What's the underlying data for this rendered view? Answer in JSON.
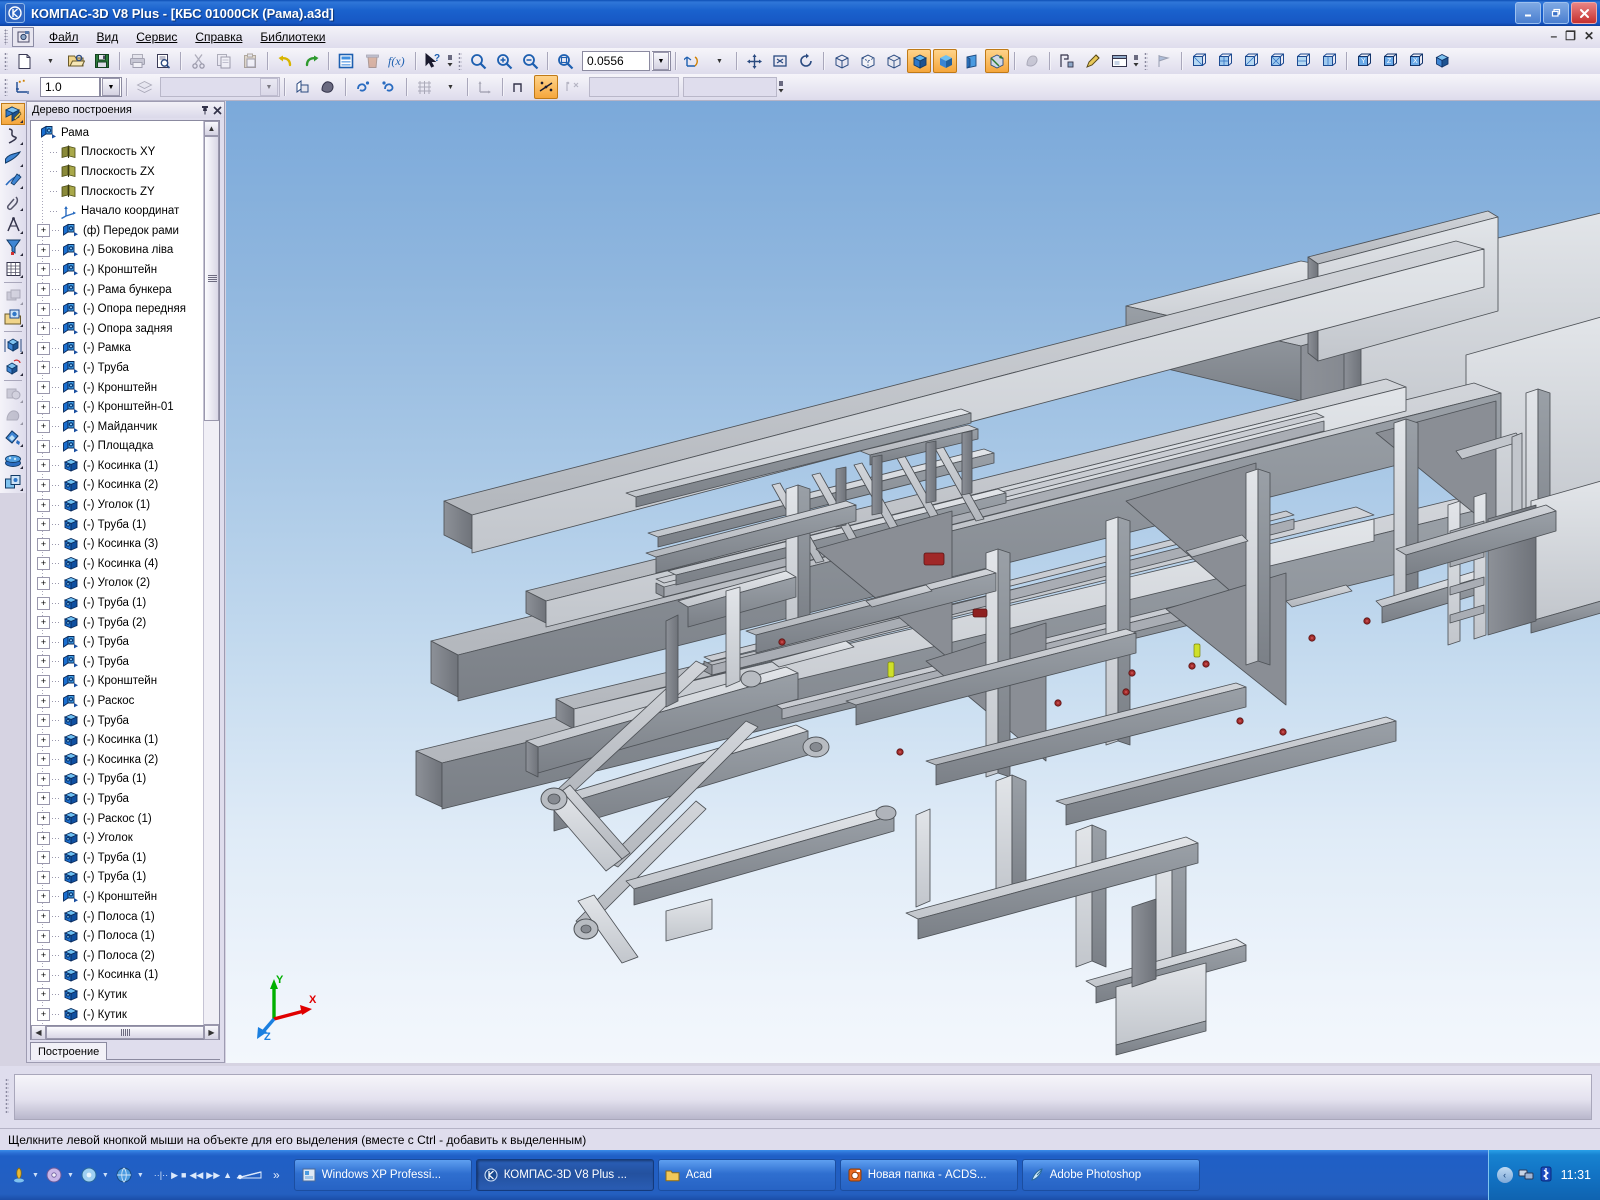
{
  "window": {
    "title": "КОМПАС-3D V8 Plus - [КБС 01000СК (Рама).a3d]",
    "app_icon": "kompas-logo-icon",
    "buttons": {
      "minimize": "_",
      "restore": "❐",
      "close": "✕"
    },
    "mdi_buttons": {
      "minimize": "–",
      "restore": "❐",
      "close": "✕"
    }
  },
  "menu": {
    "items": [
      {
        "label": "Файл"
      },
      {
        "label": "Вид"
      },
      {
        "label": "Сервис"
      },
      {
        "label": "Справка"
      },
      {
        "label": "Библиотеки"
      }
    ]
  },
  "toolbar_standard": {
    "buttons": [
      {
        "name": "new-document",
        "icon": "page-icon"
      },
      {
        "name": "new-document-dropdown",
        "icon": "chevron-down-icon"
      },
      {
        "name": "open-document",
        "icon": "folder-open-icon"
      },
      {
        "name": "save-document",
        "icon": "floppy-disk-icon"
      },
      {
        "name": "print",
        "icon": "printer-icon"
      },
      {
        "name": "print-preview",
        "icon": "preview-icon"
      },
      {
        "name": "cut",
        "icon": "scissors-icon"
      },
      {
        "name": "copy",
        "icon": "copy-icon"
      },
      {
        "name": "paste",
        "icon": "paste-icon"
      },
      {
        "name": "undo",
        "icon": "undo-arrow-icon"
      },
      {
        "name": "redo",
        "icon": "redo-arrow-icon"
      },
      {
        "name": "properties",
        "icon": "properties-icon"
      },
      {
        "name": "delete-object",
        "icon": "trash-icon"
      },
      {
        "name": "variables",
        "icon": "fx-icon"
      },
      {
        "name": "context-help",
        "icon": "arrow-question-icon"
      }
    ]
  },
  "toolbar_view": {
    "zoom_buttons": [
      {
        "name": "zoom-window",
        "icon": "magnifier-icon"
      },
      {
        "name": "zoom-in",
        "icon": "magnifier-plus-icon"
      },
      {
        "name": "zoom-out",
        "icon": "magnifier-minus-icon"
      },
      {
        "name": "zoom-to-fit",
        "icon": "magnifier-fit-icon"
      }
    ],
    "scale_value": "0.0556",
    "rotate_icon": "rotate-3d-icon"
  },
  "toolbar_orientation": {
    "buttons": [
      {
        "name": "pan-view",
        "icon": "move-arrows-icon"
      },
      {
        "name": "zoom-region",
        "icon": "zoom-region-icon"
      },
      {
        "name": "refresh-view",
        "icon": "refresh-icon"
      },
      {
        "name": "wireframe",
        "icon": "wireframe-cube-icon"
      },
      {
        "name": "hidden-lines-thin",
        "icon": "hidden-lines-cube-icon"
      },
      {
        "name": "no-hidden-lines",
        "icon": "no-hidden-lines-cube-icon"
      },
      {
        "name": "shaded-with-edges",
        "icon": "shaded-edges-cube-icon",
        "active": true
      },
      {
        "name": "shaded",
        "icon": "shaded-cube-icon",
        "active": true
      },
      {
        "name": "perspective",
        "icon": "perspective-icon"
      },
      {
        "name": "section-view",
        "icon": "section-cube-icon",
        "active": true
      },
      {
        "name": "simplify-display",
        "icon": "simplify-icon"
      },
      {
        "name": "light-source",
        "icon": "light-source-icon"
      },
      {
        "name": "edit-materials",
        "icon": "brush-icon"
      },
      {
        "name": "new-window",
        "icon": "window-icon"
      }
    ]
  },
  "toolbar_views": {
    "buttons": [
      {
        "name": "view-list",
        "icon": "view-flag-icon"
      },
      {
        "name": "view-front",
        "icon": "cube-front-icon"
      },
      {
        "name": "view-back",
        "icon": "cube-back-icon"
      },
      {
        "name": "view-left",
        "icon": "cube-left-icon"
      },
      {
        "name": "view-right",
        "icon": "cube-right-icon"
      },
      {
        "name": "view-top",
        "icon": "cube-top-icon"
      },
      {
        "name": "view-bottom",
        "icon": "cube-bottom-icon"
      },
      {
        "name": "view-isometric-xyz",
        "icon": "cube-iso-y-icon"
      },
      {
        "name": "view-isometric-yzx",
        "icon": "cube-iso-z-icon"
      },
      {
        "name": "view-isometric-zxy",
        "icon": "cube-iso-x-icon"
      },
      {
        "name": "view-dimetry",
        "icon": "cube-dimetry-icon"
      }
    ]
  },
  "toolbar_current_state": {
    "snap_value": "1.0",
    "buttons": [
      {
        "name": "snap-points",
        "icon": "snap-points-icon"
      },
      {
        "name": "layers",
        "icon": "layers-icon"
      },
      {
        "name": "hide-show-objects",
        "icon": "hide-objects-icon"
      },
      {
        "name": "hide-bodies",
        "icon": "hide-bodies-icon"
      },
      {
        "name": "hide-constraints",
        "icon": "hide-constraint-icon"
      },
      {
        "name": "show-constraints",
        "icon": "show-constraint-icon"
      },
      {
        "name": "grid",
        "icon": "grid-icon"
      },
      {
        "name": "grid-dropdown",
        "icon": "chevron-down-icon"
      },
      {
        "name": "local-coordinates",
        "icon": "local-cs-icon"
      },
      {
        "name": "ortho-mode",
        "icon": "ortho-icon"
      },
      {
        "name": "global-snaps",
        "icon": "global-snap-icon",
        "active": true
      },
      {
        "name": "disable-snaps",
        "icon": "disable-snap-icon"
      }
    ],
    "layer_field": "",
    "field_a": "",
    "field_b": ""
  },
  "left_toolbar": {
    "buttons": [
      {
        "name": "edit-model-tool",
        "icon": "edit-model-icon",
        "active": true
      },
      {
        "name": "spatial-curves-tool",
        "icon": "spline-icon"
      },
      {
        "name": "surfaces-tool",
        "icon": "surface-icon"
      },
      {
        "name": "sketch-tool",
        "icon": "sketch-icon"
      },
      {
        "name": "auxiliary-geometry-tool",
        "icon": "paperclip-icon"
      },
      {
        "name": "measure-tool",
        "icon": "compass-icon"
      },
      {
        "name": "filters-tool",
        "icon": "filter-icon"
      },
      {
        "name": "specification-tool",
        "icon": "spreadsheet-icon"
      },
      {
        "name": "array-tool",
        "icon": "array-icon"
      },
      {
        "name": "insert-component-tool",
        "icon": "insert-part-icon"
      },
      {
        "name": "mate-tool",
        "icon": "mate-cube-icon"
      },
      {
        "name": "move-component-tool",
        "icon": "move-cube-icon"
      },
      {
        "name": "boolean-tool",
        "icon": "boolean-icon"
      },
      {
        "name": "cut-tool",
        "icon": "cut-solid-icon"
      },
      {
        "name": "properties-tool",
        "icon": "material-icon"
      },
      {
        "name": "library-tool",
        "icon": "library-icon"
      },
      {
        "name": "components-tool",
        "icon": "components-icon"
      }
    ]
  },
  "tree_panel": {
    "header": {
      "title": "Дерево построения",
      "pin_icon": "pin-icon",
      "close_icon": "close-icon"
    },
    "root": {
      "label": "Рама",
      "icon": "assembly-icon"
    },
    "items": [
      {
        "label": "Плоскость XY",
        "icon": "plane-icon",
        "expandable": false
      },
      {
        "label": "Плоскость ZX",
        "icon": "plane-icon",
        "expandable": false
      },
      {
        "label": "Плоскость ZY",
        "icon": "plane-icon",
        "expandable": false
      },
      {
        "label": "Начало координат",
        "icon": "origin-icon",
        "expandable": false
      },
      {
        "label": "(ф) Передок рами",
        "icon": "assembly-icon",
        "expandable": true
      },
      {
        "label": "(-) Боковина ліва",
        "icon": "assembly-icon",
        "expandable": true
      },
      {
        "label": "(-) Кронштейн",
        "icon": "assembly-icon",
        "expandable": true
      },
      {
        "label": "(-) Рама бункера",
        "icon": "assembly-icon",
        "expandable": true
      },
      {
        "label": "(-) Опора передняя",
        "icon": "assembly-icon",
        "expandable": true
      },
      {
        "label": "(-) Опора задняя",
        "icon": "assembly-icon",
        "expandable": true
      },
      {
        "label": "(-) Рамка",
        "icon": "assembly-icon",
        "expandable": true
      },
      {
        "label": "(-) Труба",
        "icon": "assembly-icon",
        "expandable": true
      },
      {
        "label": "(-) Кронштейн",
        "icon": "assembly-icon",
        "expandable": true
      },
      {
        "label": "(-) Кронштейн-01",
        "icon": "assembly-icon",
        "expandable": true
      },
      {
        "label": "(-) Майданчик",
        "icon": "assembly-icon",
        "expandable": true
      },
      {
        "label": "(-) Площадка",
        "icon": "assembly-icon",
        "expandable": true
      },
      {
        "label": "(-) Косинка (1)",
        "icon": "part-icon",
        "expandable": true
      },
      {
        "label": "(-) Косинка (2)",
        "icon": "part-icon",
        "expandable": true
      },
      {
        "label": "(-) Уголок (1)",
        "icon": "part-icon",
        "expandable": true
      },
      {
        "label": "(-)  Труба (1)",
        "icon": "part-icon",
        "expandable": true
      },
      {
        "label": "(-) Косинка (3)",
        "icon": "part-icon",
        "expandable": true
      },
      {
        "label": "(-) Косинка (4)",
        "icon": "part-icon",
        "expandable": true
      },
      {
        "label": "(-) Уголок (2)",
        "icon": "part-icon",
        "expandable": true
      },
      {
        "label": "(-)  Труба (1)",
        "icon": "part-icon",
        "expandable": true
      },
      {
        "label": "(-)  Труба (2)",
        "icon": "part-icon",
        "expandable": true
      },
      {
        "label": "(-) Труба",
        "icon": "assembly-icon",
        "expandable": true
      },
      {
        "label": "(-) Труба",
        "icon": "assembly-icon",
        "expandable": true
      },
      {
        "label": "(-) Кронштейн",
        "icon": "assembly-icon",
        "expandable": true
      },
      {
        "label": "(-) Раскос",
        "icon": "assembly-icon",
        "expandable": true
      },
      {
        "label": "(-) Труба",
        "icon": "part-icon",
        "expandable": true
      },
      {
        "label": "(-) Косинка (1)",
        "icon": "part-icon",
        "expandable": true
      },
      {
        "label": "(-) Косинка (2)",
        "icon": "part-icon",
        "expandable": true
      },
      {
        "label": "(-)  Труба (1)",
        "icon": "part-icon",
        "expandable": true
      },
      {
        "label": "(-)  Труба",
        "icon": "part-icon",
        "expandable": true
      },
      {
        "label": "(-) Раскос (1)",
        "icon": "part-icon",
        "expandable": true
      },
      {
        "label": "(-)  Уголок",
        "icon": "part-icon",
        "expandable": true
      },
      {
        "label": "(-)  Труба (1)",
        "icon": "part-icon",
        "expandable": true
      },
      {
        "label": "(-)  Труба (1)",
        "icon": "part-icon",
        "expandable": true
      },
      {
        "label": "(-) Кронштейн",
        "icon": "assembly-icon",
        "expandable": true
      },
      {
        "label": "(-)  Полоса (1)",
        "icon": "part-icon",
        "expandable": true
      },
      {
        "label": "(-) Полоса (1)",
        "icon": "part-icon",
        "expandable": true
      },
      {
        "label": "(-) Полоса (2)",
        "icon": "part-icon",
        "expandable": true
      },
      {
        "label": "(-) Косинка (1)",
        "icon": "part-icon",
        "expandable": true
      },
      {
        "label": "(-) Кутик",
        "icon": "part-icon",
        "expandable": true
      },
      {
        "label": "(-) Кутик",
        "icon": "part-icon",
        "expandable": true
      }
    ],
    "tab": {
      "label": "Построение"
    },
    "scroll": {
      "up_arrow": "▲",
      "down_arrow": "▼",
      "left_arrow": "◀",
      "right_arrow": "▶"
    }
  },
  "viewport": {
    "model_name": "Рама",
    "axes": {
      "x": "X",
      "y": "Y",
      "z": "Z"
    },
    "axis_colors": {
      "x": "#e00000",
      "y": "#00b000",
      "z": "#1a7fe0"
    },
    "background_top": "#7ba9da",
    "background_bottom": "#f3f7fc",
    "model_color": "#b9bcc2"
  },
  "status_bar": {
    "message": "Щелкните левой кнопкой мыши на объекте для его выделения (вместе с Ctrl - добавить к выделенным)"
  },
  "taskbar": {
    "start_items": [
      {
        "name": "quick-launch-media",
        "icon": "media-icon"
      },
      {
        "name": "quick-launch-disc",
        "icon": "disc-icon"
      },
      {
        "name": "quick-launch-volume",
        "icon": "volume-icon"
      },
      {
        "name": "quick-launch-browser",
        "icon": "browser-icon"
      }
    ],
    "media_controls": [
      "▶",
      "■",
      "◀◀",
      "▶▶",
      "▲"
    ],
    "more": "»",
    "tasks": [
      {
        "label": "Windows XP Professi...",
        "icon": "windows-icon",
        "active": false
      },
      {
        "label": "КОМПАС-3D V8 Plus ...",
        "icon": "kompas-logo-icon",
        "active": true
      },
      {
        "label": "Acad",
        "icon": "folder-icon",
        "active": false
      },
      {
        "label": "Новая папка - ACDS...",
        "icon": "acdsee-icon",
        "active": false
      },
      {
        "label": "Adobe Photoshop",
        "icon": "photoshop-icon",
        "active": false
      }
    ],
    "tray": {
      "chevron": "‹",
      "icons": [
        {
          "name": "network-icon"
        },
        {
          "name": "bluetooth-icon"
        }
      ],
      "clock": "11:31"
    }
  }
}
